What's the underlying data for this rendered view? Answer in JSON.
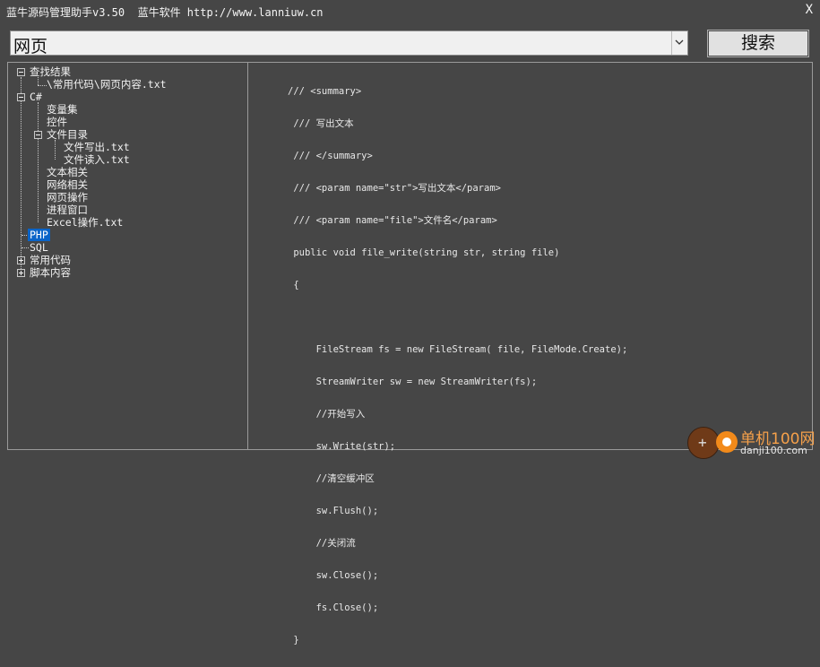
{
  "window": {
    "title": "蓝牛源码管理助手v3.50  蓝牛软件 http://www.lanniuw.cn",
    "close_label": "X"
  },
  "search": {
    "value": "网页",
    "button_label": "搜索"
  },
  "tree": {
    "n0": "查找结果",
    "n1": "\\常用代码\\网页内容.txt",
    "n2": "C#",
    "n3": "变量集",
    "n4": "控件",
    "n5": "文件目录",
    "n6": "文件写出.txt",
    "n7": "文件读入.txt",
    "n8": "文本相关",
    "n9": "网络相关",
    "n10": "网页操作",
    "n11": "进程窗口",
    "n12": "Excel操作.txt",
    "n13": "PHP",
    "n14": "SQL",
    "n15": "常用代码",
    "n16": "脚本内容",
    "selected": "PHP"
  },
  "code": {
    "l0": "/// <summary>",
    "l1": " /// 写出文本",
    "l2": " /// </summary>",
    "l3": " /// <param name=\"str\">写出文本</param>",
    "l4": " /// <param name=\"file\">文件名</param>",
    "l5": " public void file_write(string str, string file)",
    "l6": " {",
    "l7": "",
    "l8": "     FileStream fs = new FileStream( file, FileMode.Create);",
    "l9": "     StreamWriter sw = new StreamWriter(fs);",
    "l10": "     //开始写入",
    "l11": "     sw.Write(str);",
    "l12": "     //清空缓冲区",
    "l13": "     sw.Flush();",
    "l14": "     //关闭流",
    "l15": "     sw.Close();",
    "l16": "     fs.Close();",
    "l17": " }"
  },
  "watermark": {
    "brand": "单机100网",
    "url": "danji100.com"
  },
  "colors": {
    "background": "#464646",
    "selection": "#0a64c8",
    "watermark_orange": "#f28a1a"
  }
}
